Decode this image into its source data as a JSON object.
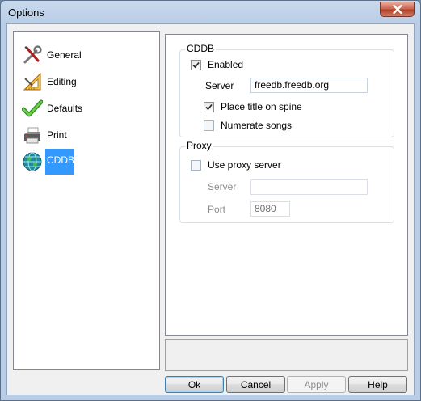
{
  "window": {
    "title": "Options"
  },
  "categories": [
    {
      "label": "General",
      "icon": "tools-icon"
    },
    {
      "label": "Editing",
      "icon": "ruler-triangle-icon"
    },
    {
      "label": "Defaults",
      "icon": "checkmark-icon"
    },
    {
      "label": "Print",
      "icon": "printer-icon"
    },
    {
      "label": "CDDB",
      "icon": "globe-icon",
      "selected": true
    }
  ],
  "cddb": {
    "group_title": "CDDB",
    "enabled_label": "Enabled",
    "enabled": true,
    "server_label": "Server",
    "server_value": "freedb.freedb.org",
    "place_title_label": "Place title on spine",
    "place_title": true,
    "numerate_label": "Numerate songs",
    "numerate": false
  },
  "proxy": {
    "group_title": "Proxy",
    "use_proxy_label": "Use proxy server",
    "use_proxy": false,
    "server_label": "Server",
    "server_value": "",
    "port_label": "Port",
    "port_value": "8080"
  },
  "buttons": {
    "ok": "Ok",
    "cancel": "Cancel",
    "apply": "Apply",
    "help": "Help"
  },
  "colors": {
    "selection": "#3399ff",
    "close_button": "#c9604a"
  }
}
